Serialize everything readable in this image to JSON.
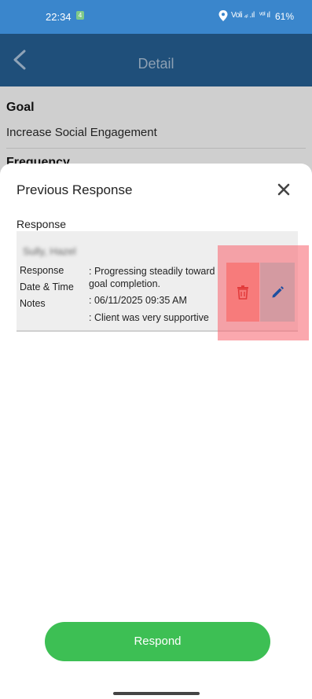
{
  "status_bar": {
    "time": "22:34",
    "badge": "4",
    "signal_1": "Voli ₄ₗ .ıl",
    "signal_2": "ᵛᵒᴵ ıl",
    "battery": "61%"
  },
  "app_bar": {
    "title": "Detail"
  },
  "background": {
    "goal_label": "Goal",
    "goal_value": "Increase Social Engagement",
    "frequency_label": "Frequency"
  },
  "sheet": {
    "title": "Previous Response",
    "section_label": "Response",
    "entry": {
      "name": "Sully, Hazel",
      "labels": {
        "response": "Response",
        "datetime": "Date & Time",
        "notes": "Notes"
      },
      "values": {
        "response": ": Progressing steadily toward goal completion.",
        "datetime": ": 06/11/2025 09:35 AM",
        "notes": ": Client was very supportive"
      }
    }
  },
  "respond_button": {
    "label": "Respond"
  },
  "colors": {
    "status_bar": "#3a86cc",
    "app_bar": "#1f4f7a",
    "primary_button": "#3dbf54",
    "delete": "#f77b7b",
    "edit_icon": "#1d4fa0",
    "highlight": "#f86e78"
  }
}
